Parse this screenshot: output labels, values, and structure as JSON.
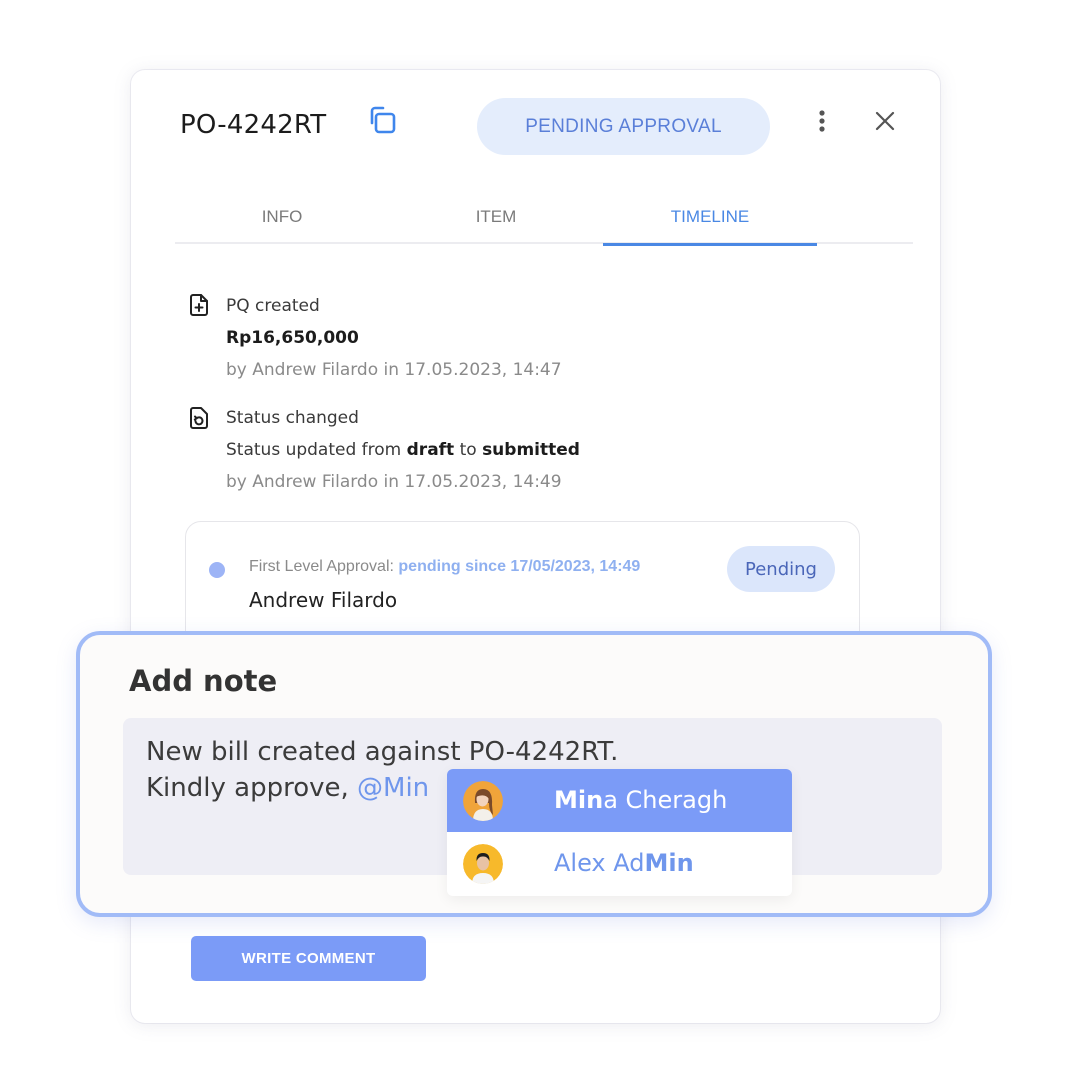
{
  "header": {
    "po_number": "PO-4242RT",
    "status_label": "PENDING APPROVAL",
    "copy_icon": "copy-icon",
    "more_icon": "more-vertical-icon",
    "close_icon": "close-icon"
  },
  "tabs": [
    {
      "label": "INFO",
      "active": false
    },
    {
      "label": "ITEM",
      "active": false
    },
    {
      "label": "TIMELINE",
      "active": true
    }
  ],
  "timeline": [
    {
      "icon": "file-plus-icon",
      "title": "PQ created",
      "amount": "Rp16,650,000",
      "meta": "by Andrew Filardo in 17.05.2023, 14:47"
    },
    {
      "icon": "file-refresh-icon",
      "title": "Status changed",
      "sub_prefix": "Status updated from ",
      "from": "draft",
      "sub_mid": " to ",
      "to": "submitted",
      "meta": "by Andrew Filardo in 17.05.2023, 14:49"
    }
  ],
  "approval": {
    "label": "First Level Approval: ",
    "since": "pending since 17/05/2023, 14:49",
    "approver": "Andrew Filardo",
    "badge": "Pending"
  },
  "note": {
    "title": "Add note",
    "line1": "New bill created against PO-4242RT.",
    "line2_prefix": "Kindly approve, ",
    "mention": "@Min"
  },
  "mention_dropdown": [
    {
      "match": "Min",
      "rest": "a Cheragh",
      "highlighted": true,
      "avatar_color": "#f0a43a"
    },
    {
      "prefix": "Alex Ad",
      "match": "Min",
      "highlighted": false,
      "avatar_color": "#f7b92b"
    }
  ],
  "actions": {
    "write_comment": "WRITE COMMENT"
  },
  "colors": {
    "accent": "#4a88e4",
    "button": "#7b9bf7",
    "note_border": "#a1bbf7",
    "pill_bg": "#e4edfc"
  }
}
